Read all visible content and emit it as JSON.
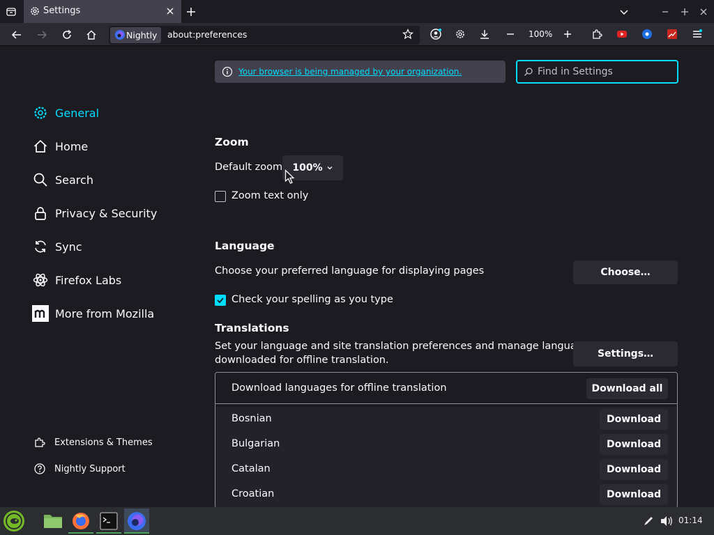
{
  "tab": {
    "title": "Settings"
  },
  "navbar": {
    "identity_label": "Nightly",
    "url": "about:preferences",
    "zoom_level": "100%"
  },
  "policy": {
    "text": "Your browser is being managed by your organization."
  },
  "search": {
    "placeholder": "Find in Settings"
  },
  "sidebar": {
    "categories": [
      {
        "label": "General",
        "icon": "gear-icon",
        "selected": true
      },
      {
        "label": "Home",
        "icon": "home-icon"
      },
      {
        "label": "Search",
        "icon": "search-icon"
      },
      {
        "label": "Privacy & Security",
        "icon": "lock-icon"
      },
      {
        "label": "Sync",
        "icon": "sync-icon"
      },
      {
        "label": "Firefox Labs",
        "icon": "atom-icon"
      },
      {
        "label": "More from Mozilla",
        "icon": "mozilla-icon"
      }
    ],
    "footer": [
      {
        "label": "Extensions & Themes",
        "icon": "puzzle-icon"
      },
      {
        "label": "Nightly Support",
        "icon": "help-icon"
      }
    ]
  },
  "zoom": {
    "heading": "Zoom",
    "default_label": "Default zoom",
    "default_value": "100%",
    "text_only_label": "Zoom text only",
    "text_only_checked": false
  },
  "language": {
    "heading": "Language",
    "description": "Choose your preferred language for displaying pages",
    "choose_button": "Choose…",
    "spellcheck_label": "Check your spelling as you type",
    "spellcheck_checked": true
  },
  "translations": {
    "heading": "Translations",
    "description_line1": "Set your language and site translation preferences and manage languages",
    "description_line2": "downloaded for offline translation.",
    "settings_button": "Settings…",
    "download_header": "Download languages for offline translation",
    "download_all_button": "Download all",
    "languages": [
      {
        "name": "Bosnian",
        "button": "Download"
      },
      {
        "name": "Bulgarian",
        "button": "Download"
      },
      {
        "name": "Catalan",
        "button": "Download"
      },
      {
        "name": "Croatian",
        "button": "Download"
      }
    ]
  },
  "taskbar": {
    "clock": "01:14"
  },
  "colors": {
    "accent": "#00ddff",
    "background": "#1c1b22",
    "button": "#2b2a33"
  }
}
